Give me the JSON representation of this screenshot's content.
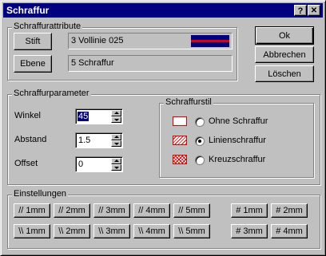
{
  "window": {
    "title": "Schraffur",
    "help_label": "?",
    "close_label": "✕"
  },
  "attributes": {
    "group_label": "Schraffurattribute",
    "stift_button": "Stift",
    "stift_value": "3 Vollinie 025",
    "stift_line_color": "#e00000",
    "stift_bg_color": "#000080",
    "ebene_button": "Ebene",
    "ebene_value": "5 Schraffur"
  },
  "actions": {
    "ok": "Ok",
    "cancel": "Abbrechen",
    "delete": "Löschen"
  },
  "parameters": {
    "group_label": "Schraffurparameter",
    "winkel_label": "Winkel",
    "winkel_value": "45",
    "abstand_label": "Abstand",
    "abstand_value": "1.5",
    "offset_label": "Offset",
    "offset_value": "0"
  },
  "style": {
    "group_label": "Schraffurstil",
    "options": [
      {
        "label": "Ohne Schraffur",
        "selected": false
      },
      {
        "label": "Linienschraffur",
        "selected": true
      },
      {
        "label": "Kreuzschraffur",
        "selected": false
      }
    ]
  },
  "settings": {
    "group_label": "Einstellungen",
    "row1": [
      "// 1mm",
      "// 2mm",
      "// 3mm",
      "// 4mm",
      "// 5mm"
    ],
    "row2": [
      "\\\\ 1mm",
      "\\\\ 2mm",
      "\\\\ 3mm",
      "\\\\ 4mm",
      "\\\\ 5mm"
    ],
    "cross_row1": [
      "# 1mm",
      "# 2mm"
    ],
    "cross_row2": [
      "# 3mm",
      "# 4mm"
    ]
  }
}
